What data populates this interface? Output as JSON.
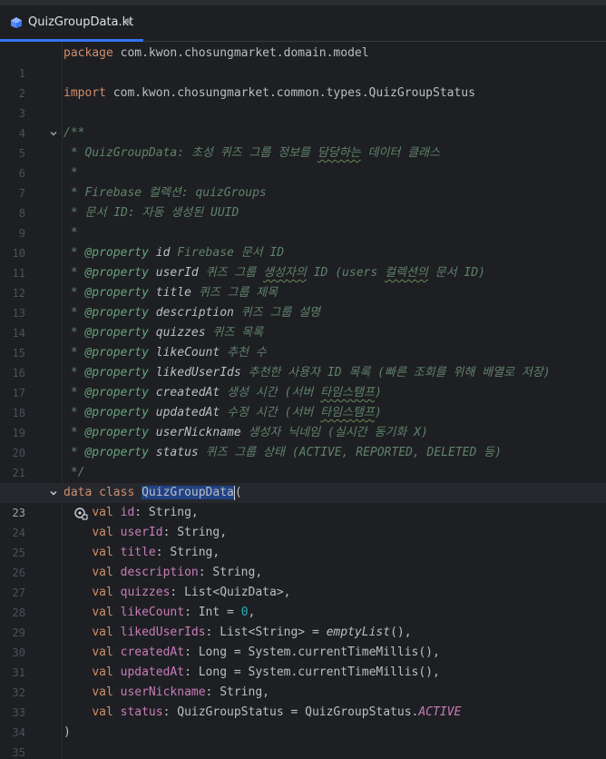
{
  "tab": {
    "filename": "QuizGroupData.kt",
    "close_glyph": "×"
  },
  "lines": [
    {
      "n": "1",
      "package_kw": "package",
      "package_name": " com.kwon.chosungmarket.domain.model"
    },
    {
      "n": "2"
    },
    {
      "n": "3",
      "import_kw": "import",
      "import_name": " com.kwon.chosungmarket.common.types.QuizGroupStatus"
    },
    {
      "n": "4"
    },
    {
      "n": "5",
      "text": "/**"
    },
    {
      "n": "6",
      "text": " * QuizGroupData: 초성 퀴즈 그룹 정보를 ",
      "typo": "담당하는",
      "text_end": " 데이터 클래스"
    },
    {
      "n": "7",
      "text": " *"
    },
    {
      "n": "8",
      "text": " * Firebase 컬렉션: quizGroups"
    },
    {
      "n": "9",
      "text": " * 문서 ID: 자동 생성된 UUID"
    },
    {
      "n": "10",
      "text": " *"
    },
    {
      "n": "11",
      "prefix": " * ",
      "tag": "@property",
      "param": " id",
      "desc": " Firebase 문서 ID"
    },
    {
      "n": "12",
      "prefix": " * ",
      "tag": "@property",
      "param": " userId",
      "desc_a": " 퀴즈 그룹 ",
      "desc_typo": "생성자의",
      "desc_b": " ID (users ",
      "desc_typo2": "컬렉션의",
      "desc_c": " 문서 ID)"
    },
    {
      "n": "13",
      "prefix": " * ",
      "tag": "@property",
      "param": " title",
      "desc": " 퀴즈 그룹 제목"
    },
    {
      "n": "14",
      "prefix": " * ",
      "tag": "@property",
      "param": " description",
      "desc": " 퀴즈 그룹 설명"
    },
    {
      "n": "15",
      "prefix": " * ",
      "tag": "@property",
      "param": " quizzes",
      "desc": " 퀴즈 목록"
    },
    {
      "n": "16",
      "prefix": " * ",
      "tag": "@property",
      "param": " likeCount",
      "desc": " 추천 수"
    },
    {
      "n": "17",
      "prefix": " * ",
      "tag": "@property",
      "param": " likedUserIds",
      "desc": " 추천한 사용자 ID 목록 (빠른 조회를 위해 배열로 저장)"
    },
    {
      "n": "18",
      "prefix": " * ",
      "tag": "@property",
      "param": " createdAt",
      "desc_a": " 생성 시간 (서버 ",
      "desc_typo": "타임스탬프",
      "desc_b": ")"
    },
    {
      "n": "19",
      "prefix": " * ",
      "tag": "@property",
      "param": " updatedAt",
      "desc_a": " 수정 시간 (서버 ",
      "desc_typo": "타임스탬프",
      "desc_b": ")"
    },
    {
      "n": "20",
      "prefix": " * ",
      "tag": "@property",
      "param": " userNickname",
      "desc": " 생성자 닉네임 (실시간 동기화 X)"
    },
    {
      "n": "21",
      "prefix": " * ",
      "tag": "@property",
      "param": " status",
      "desc": " 퀴즈 그룹 상태 (ACTIVE, REPORTED, DELETED 등)"
    },
    {
      "n": "22",
      "text": " */"
    },
    {
      "n": "23",
      "kw": "data class",
      "cls": "QuizGroupData",
      "rest": "("
    },
    {
      "n": "24",
      "kw": "val",
      "prop": "id",
      "type": ": String,"
    },
    {
      "n": "25",
      "kw": "val",
      "prop": "userId",
      "type": ": String,"
    },
    {
      "n": "26",
      "kw": "val",
      "prop": "title",
      "type": ": String,"
    },
    {
      "n": "27",
      "kw": "val",
      "prop": "description",
      "type": ": String,"
    },
    {
      "n": "28",
      "kw": "val",
      "prop": "quizzes",
      "type": ": List<QuizData>,"
    },
    {
      "n": "29",
      "kw": "val",
      "prop": "likeCount",
      "type": ": Int = ",
      "num": "0",
      "tail": ","
    },
    {
      "n": "30",
      "kw": "val",
      "prop": "likedUserIds",
      "type": ": List<String> = ",
      "fn": "emptyList",
      "tail": "(),"
    },
    {
      "n": "31",
      "kw": "val",
      "prop": "createdAt",
      "type": ": Long = System.currentTimeMillis(),"
    },
    {
      "n": "32",
      "kw": "val",
      "prop": "updatedAt",
      "type": ": Long = System.currentTimeMillis(),"
    },
    {
      "n": "33",
      "kw": "val",
      "prop": "userNickname",
      "type": ": String,"
    },
    {
      "n": "34",
      "kw": "val",
      "prop": "status",
      "type": ": QuizGroupStatus = QuizGroupStatus.",
      "const": "ACTIVE"
    },
    {
      "n": "35",
      "text": ")"
    }
  ],
  "colors": {
    "background": "#1e1f22",
    "keyword": "#cf8e6d",
    "comment": "#5f826b",
    "property": "#c77dbb",
    "number": "#2aacb8",
    "tab_accent": "#3574f0",
    "selection": "#214283"
  }
}
